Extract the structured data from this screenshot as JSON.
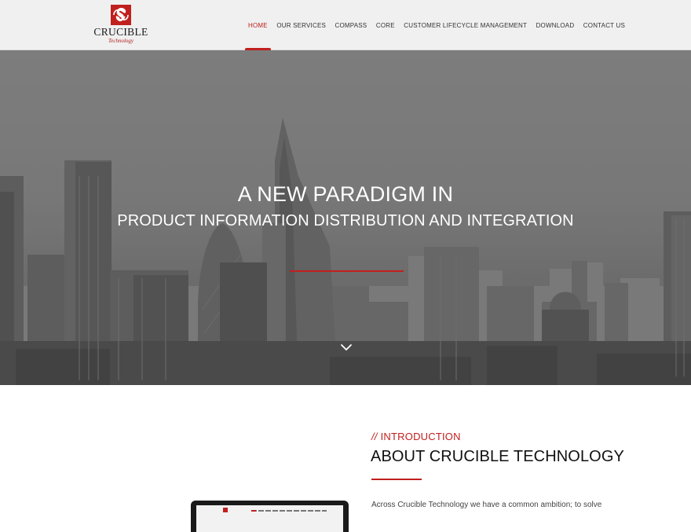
{
  "brand": {
    "name": "CRUCIBLE",
    "tagline": "Technology",
    "accent_color": "#c0201e"
  },
  "nav": {
    "items": [
      {
        "label": "HOME",
        "active": true
      },
      {
        "label": "OUR SERVICES",
        "active": false
      },
      {
        "label": "COMPASS",
        "active": false
      },
      {
        "label": "CORE",
        "active": false
      },
      {
        "label": "CUSTOMER LIFECYCLE MANAGEMENT",
        "active": false
      },
      {
        "label": "DOWNLOAD",
        "active": false
      },
      {
        "label": "CONTACT US",
        "active": false
      }
    ]
  },
  "hero": {
    "title": "A NEW PARADIGM IN",
    "subtitle": "PRODUCT INFORMATION DISTRIBUTION AND INTEGRATION",
    "scroll_icon": "chevron-down-icon"
  },
  "intro": {
    "eyebrow_prefix": "//",
    "eyebrow": "INTRODUCTION",
    "title": "ABOUT CRUCIBLE TECHNOLOGY",
    "body": "Across Crucible Technology we have a common ambition; to solve"
  }
}
